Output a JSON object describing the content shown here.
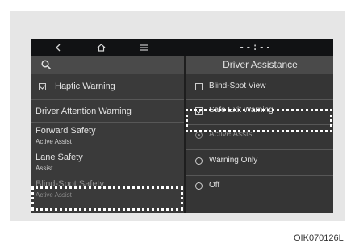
{
  "statusbar": {
    "back_icon": "back-chevron",
    "home_icon": "home",
    "menu_icon": "menu",
    "time": "--:--"
  },
  "left_menu": {
    "search_icon": "search",
    "items": [
      {
        "label": "Haptic Warning",
        "checked": true
      },
      {
        "label": "Driver Attention Warning"
      },
      {
        "label": "Forward Safety",
        "sub": "Active Assist"
      },
      {
        "label": "Lane Safety",
        "sub": "Assist"
      },
      {
        "label": "Blind-Spot Safety",
        "sub": "Active Assist"
      }
    ]
  },
  "right_panel": {
    "title": "Driver Assistance",
    "options": [
      {
        "label": "Blind-Spot View",
        "type": "checkbox",
        "checked": false
      },
      {
        "label": "Safe Exit Warning",
        "type": "checkbox",
        "checked": true
      },
      {
        "label": "Active Assist",
        "type": "radio",
        "selected": true,
        "disabled": true
      },
      {
        "label": "Warning Only",
        "type": "radio",
        "selected": false
      },
      {
        "label": "Off",
        "type": "radio",
        "selected": false
      }
    ]
  },
  "image_code": "OIK070126L"
}
